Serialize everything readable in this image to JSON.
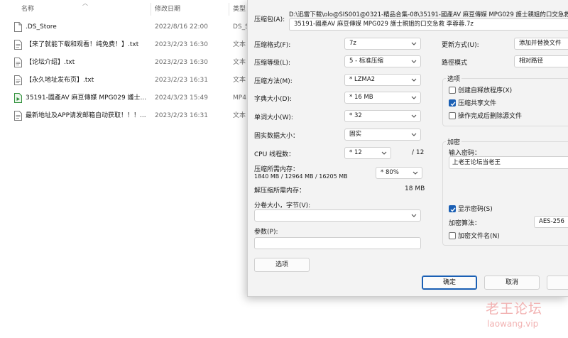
{
  "explorer": {
    "columns": {
      "name": "名称",
      "modified": "修改日期",
      "type": "类型"
    },
    "files": [
      {
        "icon": "file-icon",
        "name": ".DS_Store",
        "modified": "2022/8/16 22:00",
        "type": "DS_S"
      },
      {
        "icon": "text-file-icon",
        "name": "【来了就能下载和观看！纯免费！】.txt",
        "modified": "2023/2/23 16:30",
        "type": "文本"
      },
      {
        "icon": "text-file-icon",
        "name": "【论坛介绍】.txt",
        "modified": "2023/2/23 16:30",
        "type": "文本"
      },
      {
        "icon": "text-file-icon",
        "name": "【永久地址发布页】.txt",
        "modified": "2023/2/23 16:31",
        "type": "文本"
      },
      {
        "icon": "video-file-icon",
        "name": "35191-國產AV 麻豆傳媒 MPG029 護士...",
        "modified": "2024/3/23 15:49",
        "type": "MP4"
      },
      {
        "icon": "text-file-icon",
        "name": "最新地址及APP请发邮箱自动获取！！！...",
        "modified": "2023/2/23 16:31",
        "type": "文本"
      }
    ]
  },
  "dialog": {
    "archive_label": "压缩包(A):",
    "archive_path": "D:\\迅雷下载\\olo@SIS001@0321-精品合集-08\\35191-國產AV 麻豆傳媒 MPG029 護士親姐的口交急救 李",
    "archive_name": "35191-國產AV 麻豆傳媒 MPG029 護士親姐的口交急救 李蓉蓉.7z",
    "format_label": "压缩格式(F):",
    "format_value": "7z",
    "level_label": "压缩等级(L):",
    "level_value": "5 - 标准压缩",
    "method_label": "压缩方法(M):",
    "method_value": "* LZMA2",
    "dict_label": "字典大小(D):",
    "dict_value": "* 16 MB",
    "word_label": "单词大小(W):",
    "word_value": "* 32",
    "solid_label": "固实数据大小：",
    "solid_value": "固实",
    "threads_label": "CPU 线程数：",
    "threads_value": "* 12",
    "threads_max": "/ 12",
    "mem_label": "压缩所需内存：",
    "mem_detail": "1840 MB / 12964 MB / 16205 MB",
    "mem_value": "* 80%",
    "decomp_label": "解压缩所需内存：",
    "decomp_value": "18 MB",
    "split_label": "分卷大小，字节(V):",
    "split_value": "",
    "params_label": "参数(P):",
    "params_value": "",
    "options_button": "选项",
    "update_label": "更新方式(U):",
    "update_value": "添加并替换文件",
    "pathmode_label": "路徑模式",
    "pathmode_value": "相对路径",
    "options_group": "选项",
    "sfx_label": "创建自释放程序(X)",
    "sfx_checked": false,
    "shared_label": "压缩共享文件",
    "shared_checked": true,
    "delete_label": "操作完成后删除源文件",
    "delete_checked": false,
    "encrypt_group": "加密",
    "password_label": "输入密码：",
    "password_value": "上老王论坛当老王",
    "show_password_label": "显示密码(S)",
    "show_password_checked": true,
    "enc_method_label": "加密算法：",
    "enc_method_value": "AES-256",
    "enc_names_label": "加密文件名(N)",
    "enc_names_checked": false,
    "ok_button": "确定",
    "cancel_button": "取消"
  },
  "watermark": {
    "cn": "老王论坛",
    "en": "laowang.vip"
  },
  "colors": {
    "accent": "#1a5fb4",
    "dialog_bg": "#f3f3f3",
    "watermark": "#f2b3b3"
  }
}
